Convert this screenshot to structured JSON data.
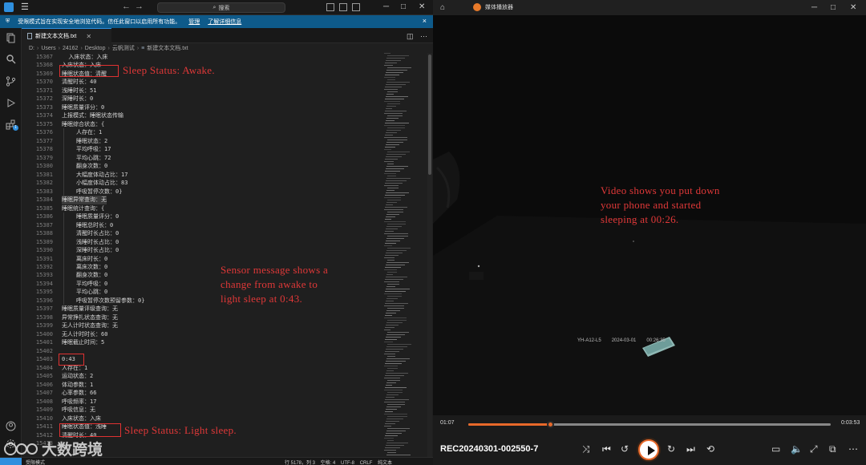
{
  "editor": {
    "search_label": "搜索",
    "notice": {
      "text": "受限模式旨在实现安全地浏览代码。信任此窗口以启用所有功能。",
      "manage": "管理",
      "learn_more": "了解详细信息",
      "close": "×"
    },
    "tab_label": "新建文本文档.txt",
    "breadcrumb": [
      "D:",
      "Users",
      "24162",
      "Desktop",
      "云帆测试",
      "新建文本文档.txt"
    ],
    "lines": [
      {
        "n": "15367",
        "t": "  入床状态：入床",
        "i": 0
      },
      {
        "n": "15368",
        "t": "入床状态：入床",
        "i": 0
      },
      {
        "n": "15369",
        "t": "睡眠状态值：清醒",
        "i": 0
      },
      {
        "n": "15370",
        "t": "清醒时长：40",
        "i": 0
      },
      {
        "n": "15371",
        "t": "浅睡时长：51",
        "i": 0
      },
      {
        "n": "15372",
        "t": "深睡时长：0",
        "i": 0
      },
      {
        "n": "15373",
        "t": "睡眠质量评分：0",
        "i": 0
      },
      {
        "n": "15374",
        "t": "上报模式：睡眠状态传输",
        "i": 0
      },
      {
        "n": "15375",
        "t": "睡眠综合状态：{",
        "i": 0
      },
      {
        "n": "15376",
        "t": "人存在：1",
        "i": 1
      },
      {
        "n": "15377",
        "t": "睡眠状态：2",
        "i": 1
      },
      {
        "n": "15378",
        "t": "平均呼吸：17",
        "i": 1
      },
      {
        "n": "15379",
        "t": "平均心跳：72",
        "i": 1
      },
      {
        "n": "15380",
        "t": "翻身次数：0",
        "i": 1
      },
      {
        "n": "15381",
        "t": "大幅度体动占比：17",
        "i": 1
      },
      {
        "n": "15382",
        "t": "小幅度体动占比：83",
        "i": 1
      },
      {
        "n": "15383",
        "t": "呼吸暂停次数：0}",
        "i": 1
      },
      {
        "n": "15384",
        "t": "睡眠异常查询：无",
        "i": 0
      },
      {
        "n": "15385",
        "t": "睡眠统计查询：{",
        "i": 0
      },
      {
        "n": "15386",
        "t": "睡眠质量评分：0",
        "i": 1
      },
      {
        "n": "15387",
        "t": "睡眠总时长：0",
        "i": 1
      },
      {
        "n": "15388",
        "t": "清醒时长占比：0",
        "i": 1
      },
      {
        "n": "15389",
        "t": "浅睡时长占比：0",
        "i": 1
      },
      {
        "n": "15390",
        "t": "深睡时长占比：0",
        "i": 1
      },
      {
        "n": "15391",
        "t": "离床时长：0",
        "i": 1
      },
      {
        "n": "15392",
        "t": "离床次数：0",
        "i": 1
      },
      {
        "n": "15393",
        "t": "翻身次数：0",
        "i": 1
      },
      {
        "n": "15394",
        "t": "平均呼吸：0",
        "i": 1
      },
      {
        "n": "15395",
        "t": "平均心跳：0",
        "i": 1
      },
      {
        "n": "15396",
        "t": "呼吸暂停次数预留参数：0}",
        "i": 1
      },
      {
        "n": "15397",
        "t": "睡眠质量评级查询：无",
        "i": 0
      },
      {
        "n": "15398",
        "t": "异常挣扎状态查询：无",
        "i": 0
      },
      {
        "n": "15399",
        "t": "无人计时状态查询：无",
        "i": 0
      },
      {
        "n": "15400",
        "t": "无人计时时长：60",
        "i": 0
      },
      {
        "n": "15401",
        "t": "睡眠截止时间：5",
        "i": 0
      },
      {
        "n": "15402",
        "t": "",
        "i": 0
      },
      {
        "n": "15403",
        "t": "0:43",
        "i": 0
      },
      {
        "n": "15404",
        "t": "人存在：1",
        "i": 0
      },
      {
        "n": "15405",
        "t": "运动状态：2",
        "i": 0
      },
      {
        "n": "15406",
        "t": "体动参数：1",
        "i": 0
      },
      {
        "n": "15407",
        "t": "心率参数：66",
        "i": 0
      },
      {
        "n": "15408",
        "t": "呼吸频率：17",
        "i": 0
      },
      {
        "n": "15409",
        "t": "呼吸信息：无",
        "i": 0
      },
      {
        "n": "15410",
        "t": "入床状态：入床",
        "i": 0
      },
      {
        "n": "15411",
        "t": "睡眠状态值：浅睡",
        "i": 0
      },
      {
        "n": "15412",
        "t": "清醒时长：40",
        "i": 0
      },
      {
        "n": "15413",
        "t": "",
        "i": 0
      }
    ],
    "status_right": "行 5178，列 3    空格: 4    UTF-8    CRLF    纯文本",
    "status_left": "受限模式"
  },
  "annotations": {
    "awake": "Sleep Status: Awake.",
    "sensor": "Sensor message shows a\nchange from awake to\nlight sleep at 0:43.",
    "light": "Sleep Status: Light sleep.",
    "video": "Video shows you put down\nyour phone and started\nsleeping at 00:26."
  },
  "player": {
    "title": "媒体播放器",
    "overlay": {
      "device": "YH-A12-L5",
      "date": "2024-03-01",
      "time": "00:26:35"
    },
    "current_time": "01:07",
    "total_time": "0:03:53",
    "progress_fraction": 0.227,
    "filename": "REC20240301-002550-7"
  },
  "watermark": "大数跨境",
  "colors": {
    "accent": "#e8692a",
    "vscode_blue": "#2f8fde",
    "annotation_red": "#e03838"
  }
}
